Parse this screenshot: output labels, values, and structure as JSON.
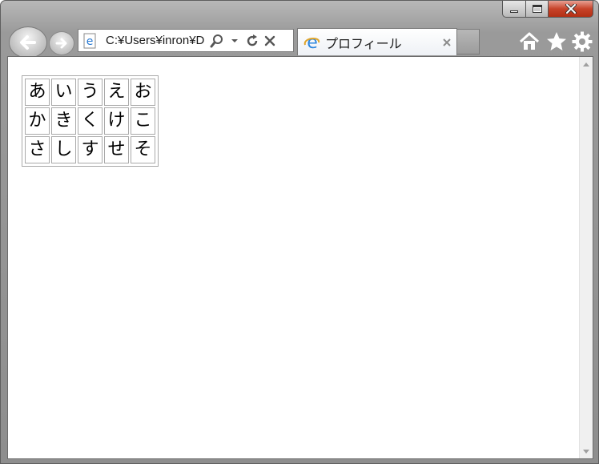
{
  "browser": {
    "address": {
      "url": "C:¥Users¥inron¥D"
    },
    "tab": {
      "title": "プロフィール"
    },
    "icons": {
      "back": "back-arrow-icon",
      "forward": "forward-arrow-icon",
      "search": "search-icon",
      "dropdown": "chevron-down-icon",
      "refresh": "refresh-icon",
      "stop": "close-icon",
      "tab_close": "close-icon",
      "home": "home-icon",
      "favorites": "star-icon",
      "tools": "gear-icon"
    }
  },
  "page": {
    "kana_rows": [
      [
        "あ",
        "い",
        "う",
        "え",
        "お"
      ],
      [
        "か",
        "き",
        "く",
        "け",
        "こ"
      ],
      [
        "さ",
        "し",
        "す",
        "せ",
        "そ"
      ]
    ]
  },
  "colors": {
    "frame": "#9a9a9a",
    "close_button": "#c7432a",
    "table_border": "#a9a9a9"
  }
}
